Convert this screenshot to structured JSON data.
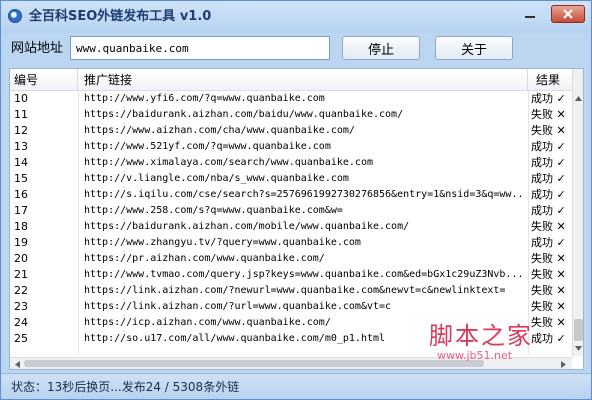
{
  "window": {
    "title": "全百科SEO外链发布工具 v1.0"
  },
  "toolbar": {
    "url_label": "网站地址",
    "url_value": "www.quanbaike.com",
    "stop_label": "停止",
    "about_label": "关于"
  },
  "table": {
    "headers": [
      "编号",
      "推广链接",
      "结果"
    ],
    "rows": [
      {
        "num": "10",
        "url": "http://www.yfi6.com/?q=www.quanbaike.com",
        "result": "成功 ✓"
      },
      {
        "num": "11",
        "url": "https://baidurank.aizhan.com/baidu/www.quanbaike.com/",
        "result": "失败 ✕"
      },
      {
        "num": "12",
        "url": "https://www.aizhan.com/cha/www.quanbaike.com/",
        "result": "失败 ✕"
      },
      {
        "num": "13",
        "url": "http://www.521yf.com/?q=www.quanbaike.com",
        "result": "成功 ✓"
      },
      {
        "num": "14",
        "url": "http://www.ximalaya.com/search/www.quanbaike.com",
        "result": "成功 ✓"
      },
      {
        "num": "15",
        "url": "http://v.liangle.com/nba/s_www.quanbaike.com",
        "result": "成功 ✓"
      },
      {
        "num": "16",
        "url": "http://s.iqilu.com/cse/search?s=2576961992730276856&entry=1&nsid=3&q=ww...",
        "result": "成功 ✓"
      },
      {
        "num": "17",
        "url": "http://www.258.com/s?q=www.quanbaike.com&w=",
        "result": "成功 ✓"
      },
      {
        "num": "18",
        "url": "https://baidurank.aizhan.com/mobile/www.quanbaike.com/",
        "result": "失败 ✕"
      },
      {
        "num": "19",
        "url": "http://www.zhangyu.tv/?query=www.quanbaike.com",
        "result": "成功 ✓"
      },
      {
        "num": "20",
        "url": "https://pr.aizhan.com/www.quanbaike.com/",
        "result": "失败 ✕"
      },
      {
        "num": "21",
        "url": "http://www.tvmao.com/query.jsp?keys=www.quanbaike.com&ed=bGx1c29uZ3Nvb...",
        "result": "失败 ✕"
      },
      {
        "num": "22",
        "url": "https://link.aizhan.com/?newurl=www.quanbaike.com&newvt=c&newlinktext=",
        "result": "失败 ✕"
      },
      {
        "num": "23",
        "url": "https://link.aizhan.com/?url=www.quanbaike.com&vt=c",
        "result": "失败 ✕"
      },
      {
        "num": "24",
        "url": "https://icp.aizhan.com/www.quanbaike.com/",
        "result": "失败 ✕"
      },
      {
        "num": "25",
        "url": "http://so.u17.com/all/www.quanbaike.com/m0_p1.html",
        "result": "成功 ✓"
      }
    ]
  },
  "status": {
    "text": "状态：13秒后换页...发布24 / 5308条外链"
  },
  "watermark": {
    "main": "脚本之家",
    "sub": "www.jb51.net"
  },
  "colors": {
    "titlebar": "#bcd6f2",
    "accent_border": "#5b8fd0",
    "watermark": "#d9395a"
  }
}
